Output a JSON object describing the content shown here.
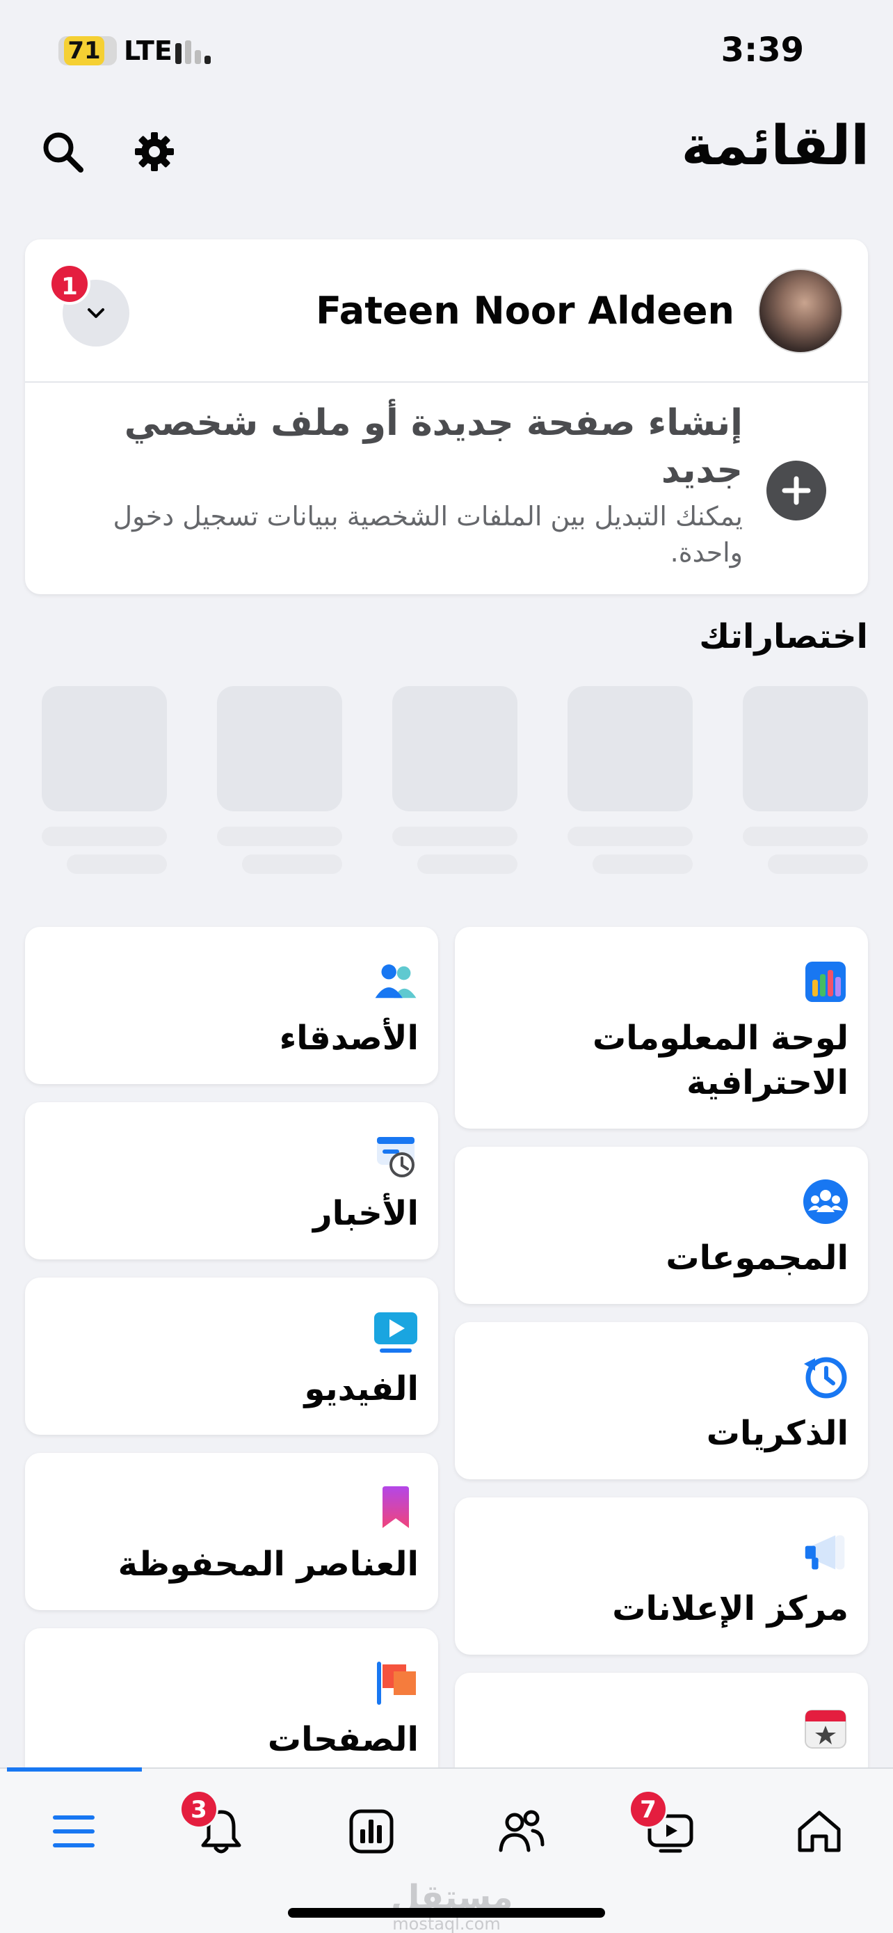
{
  "status_bar": {
    "battery": "71",
    "network": "LTE",
    "time": "3:39"
  },
  "header": {
    "title": "القائمة",
    "search_icon": "search-icon",
    "settings_icon": "gear-icon"
  },
  "profile": {
    "name": "Fateen Noor Aldeen",
    "switch_badge": "1",
    "create_title": "إنشاء صفحة جديدة أو ملف شخصي جديد",
    "create_subtitle": "يمكنك التبديل بين الملفات الشخصية ببيانات تسجيل دخول واحدة."
  },
  "shortcuts": {
    "title": "اختصاراتك"
  },
  "menu": {
    "right_column": [
      {
        "label": "لوحة المعلومات الاحترافية",
        "icon": "dashboard-icon"
      },
      {
        "label": "المجموعات",
        "icon": "groups-icon"
      },
      {
        "label": "الذكريات",
        "icon": "memories-icon"
      },
      {
        "label": "مركز الإعلانات",
        "icon": "megaphone-icon"
      },
      {
        "label": "",
        "icon": "events-calendar-icon"
      }
    ],
    "left_column": [
      {
        "label": "الأصدقاء",
        "icon": "friends-icon"
      },
      {
        "label": "الأخبار",
        "icon": "feeds-icon"
      },
      {
        "label": "الفيديو",
        "icon": "video-icon"
      },
      {
        "label": "العناصر المحفوظة",
        "icon": "saved-icon"
      },
      {
        "label": "الصفحات",
        "icon": "pages-flag-icon"
      }
    ]
  },
  "bottom_nav": {
    "notifications_badge": "3",
    "video_badge": "7",
    "watermark_ar": "مستقل",
    "watermark_en": "mostaql.com"
  },
  "colors": {
    "accent": "#1877f2",
    "badge": "#e41e3f",
    "background": "#f1f2f6"
  }
}
